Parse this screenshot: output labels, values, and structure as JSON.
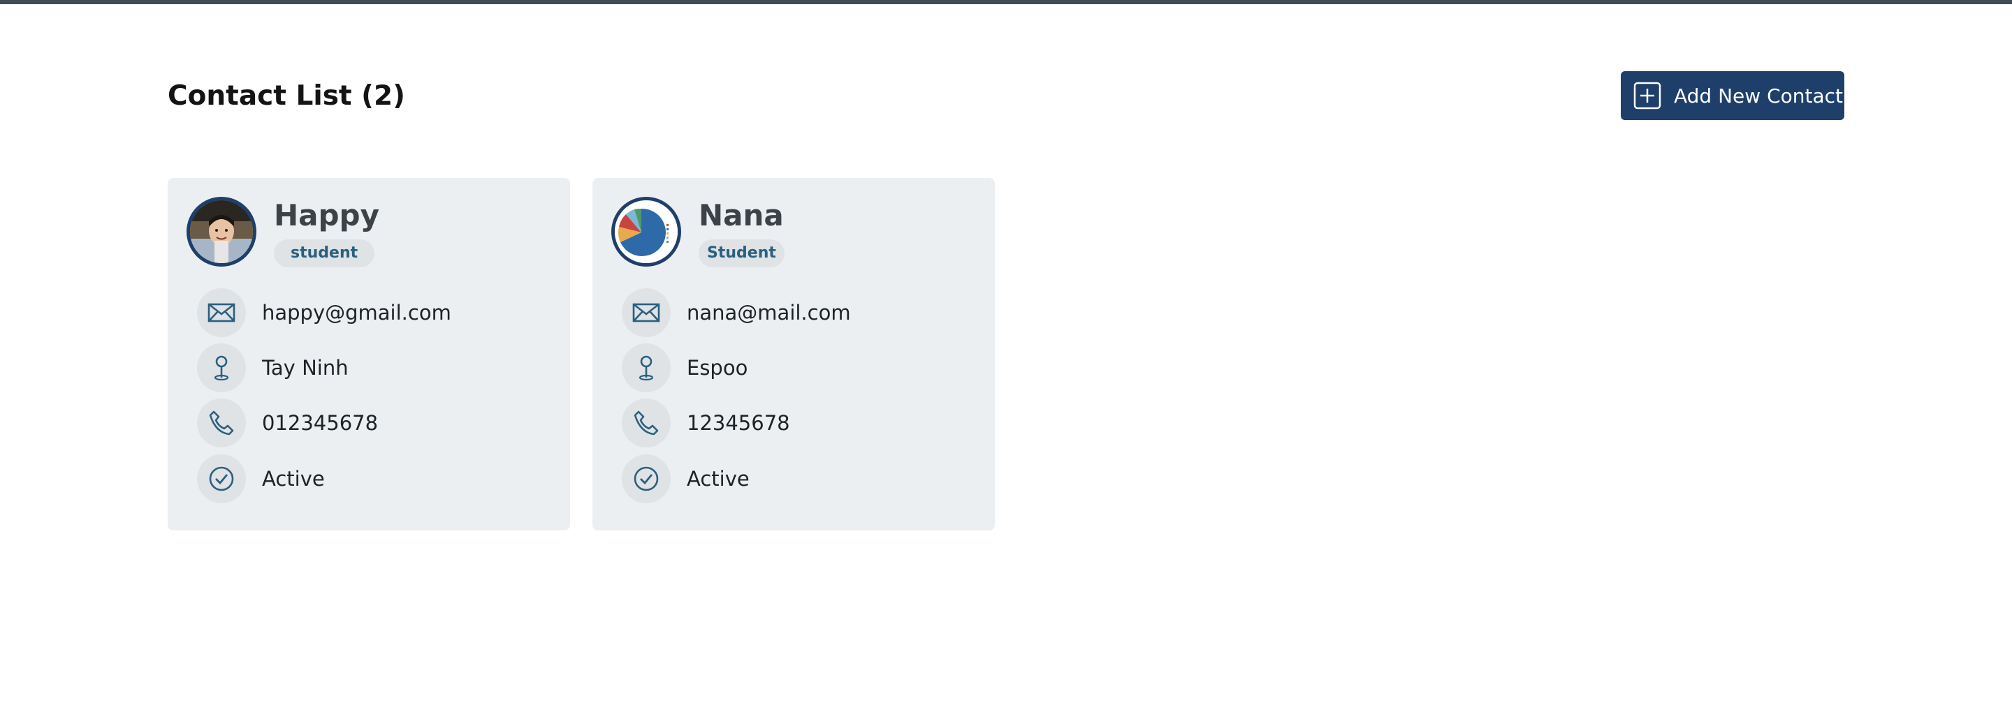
{
  "header": {
    "title": "Contact List (2)",
    "add_button_label": "Add New Contact"
  },
  "colors": {
    "primary": "#1e3f6a",
    "card_bg": "#eceff1",
    "icon_bg": "#dfe3e6",
    "icon_stroke": "#2b5f7e",
    "topbar": "#3f4d55"
  },
  "contacts": [
    {
      "name": "Happy",
      "role": "student",
      "email": "happy@gmail.com",
      "location": "Tay Ninh",
      "phone": "012345678",
      "status": "Active",
      "avatar": "photo-of-person"
    },
    {
      "name": "Nana",
      "role": "Student",
      "email": "nana@mail.com",
      "location": "Espoo",
      "phone": "12345678",
      "status": "Active",
      "avatar": "pie-chart-thumbnail"
    }
  ],
  "icons": {
    "email": "envelope-icon",
    "location": "map-pin-icon",
    "phone": "phone-icon",
    "status": "check-circle-icon",
    "add": "plus-square-icon"
  }
}
